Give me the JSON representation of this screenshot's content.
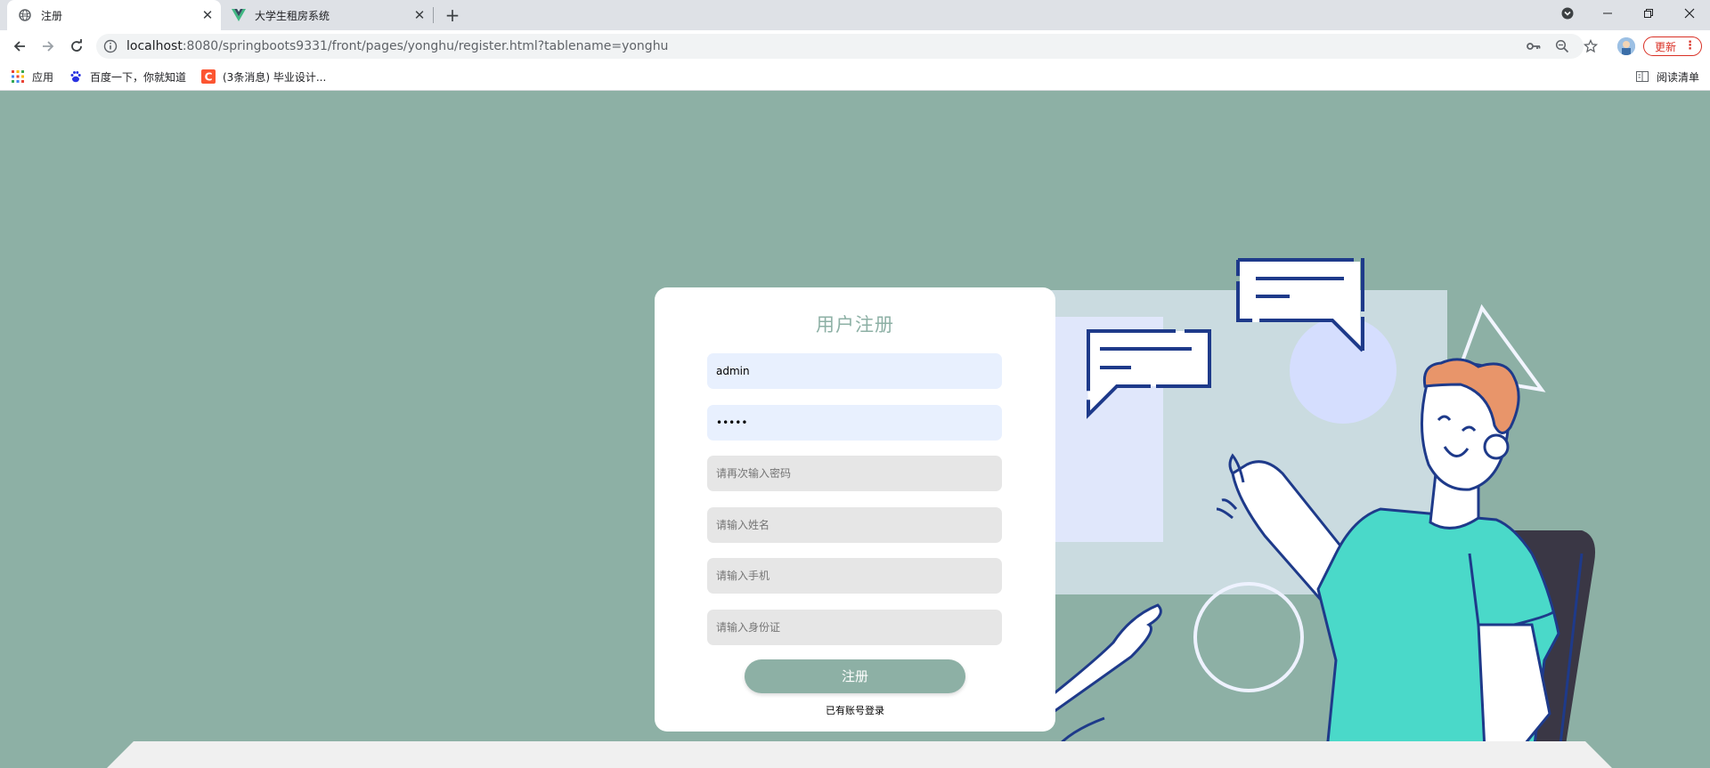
{
  "browser": {
    "tabs": [
      {
        "title": "注册",
        "icon": "globe-icon",
        "active": true
      },
      {
        "title": "大学生租房系统",
        "icon": "vue-icon",
        "active": false
      }
    ],
    "address": {
      "host": "localhost",
      "path": ":8080/springboots9331/front/pages/yonghu/register.html?tablename=yonghu"
    },
    "update_label": "更新",
    "bookmarks": [
      {
        "label": "应用",
        "icon": "apps-grid-icon"
      },
      {
        "label": "百度一下，你就知道",
        "icon": "baidu-paw-icon"
      },
      {
        "label": "(3条消息) 毕业设计...",
        "icon": "csdn-icon"
      }
    ],
    "reading_list_label": "阅读清单"
  },
  "register": {
    "title": "用户注册",
    "fields": [
      {
        "value": "admin",
        "placeholder": "",
        "filled": true
      },
      {
        "value": "•••••",
        "placeholder": "",
        "filled": true
      },
      {
        "value": "",
        "placeholder": "请再次输入密码",
        "filled": false
      },
      {
        "value": "",
        "placeholder": "请输入姓名",
        "filled": false
      },
      {
        "value": "",
        "placeholder": "请输入手机",
        "filled": false
      },
      {
        "value": "",
        "placeholder": "请输入身份证",
        "filled": false
      }
    ],
    "submit_label": "注册",
    "login_link": "已有账号登录"
  },
  "colors": {
    "page_background": "#8db0a5",
    "accent": "#8db0a5",
    "shirt": "#4ad9c9",
    "hair": "#e8956a",
    "outline": "#1e3a8a"
  }
}
